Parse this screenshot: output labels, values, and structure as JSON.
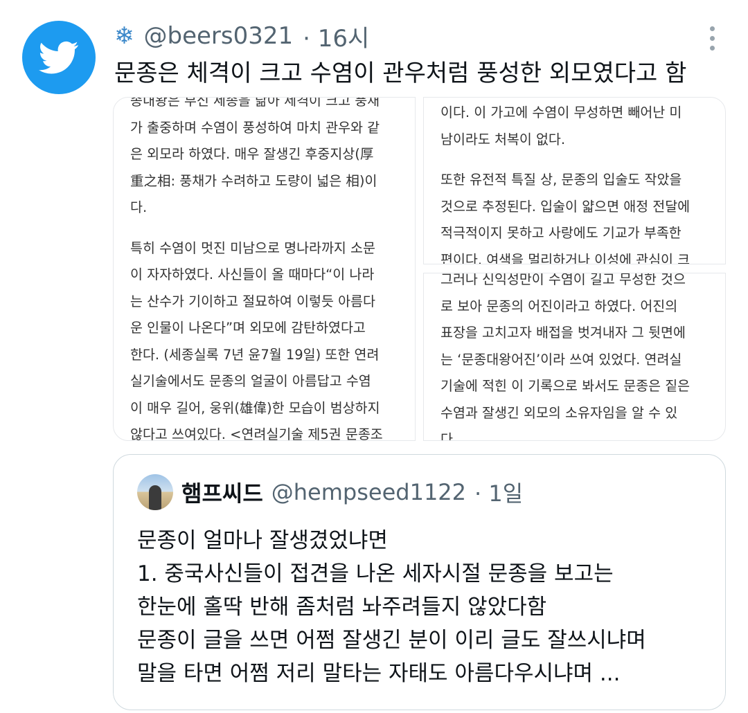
{
  "tweet": {
    "handle": "@beers0321",
    "time": "· 16시",
    "text": "문종은 체격이 크고 수염이 관우처럼 풍성한 외모였다고 함",
    "flair_icon": "snowflake-icon",
    "avatar_icon": "twitter-bird-icon",
    "accent_color": "#1d9bf0"
  },
  "media": {
    "left": [
      "종내왕은 부신 세종을 닮아 제격이 크고 풍채",
      "가 출중하며 수염이 풍성하여 마치 관우와 같",
      "은 외모라 하였다. 매우 잘생긴 후중지상(厚",
      "重之相: 풍채가 수려하고 도량이 넓은 相)이",
      "다.",
      "",
      "특히 수염이 멋진 미남으로 명나라까지 소문",
      "이 자자하였다. 사신들이 올 때마다“이 나라",
      "는 산수가 기이하고 절묘하여 이렇듯 아름다",
      "운 인물이 나온다”며 외모에 감탄하였다고",
      "한다. (세종실록 7년 윤7월 19일) 또한 연려",
      "실기술에서도 문종의 얼굴이 아름답고 수염",
      "이 매우 길어, 웅위(雄偉)한 모습이 범상하지",
      "않다고 쓰여있다. <연려실기술 제5권 문종조"
    ],
    "right_top": [
      "이다. 이 가고에 수염이 무성하면 빼어난 미",
      "남이라도 처복이 없다.",
      "",
      "또한 유전적 특질 상, 문종의 입술도 작았을",
      "것으로 추정된다. 입술이 얇으면 애정 전달에",
      "적극적이지 못하고 사랑에도 기교가 부족한",
      "편이다. 여색을 멀리하거나 이성에 관심이 크"
    ],
    "right_bottom": [
      "그러나 신익성만이 수염이 길고 무성한 것으",
      "로 보아 문종의 어진이라고 하였다. 어진의",
      "표장을 고치고자 배접을 벗겨내자 그 뒷면에",
      "는 ‘문종대왕어진’이라 쓰여 있었다. 연려실",
      "기술에 적힌 이 기록으로 봐서도 문종은 짙은",
      "수염과 잘생긴 외모의 소유자임을 알 수 있",
      "다."
    ]
  },
  "quote": {
    "name": "햄프씨드",
    "handle": "@hempseed1122",
    "time": "· 1일",
    "lines": [
      "문종이 얼마나 잘생겼었냐면",
      "1. 중국사신들이 접견을 나온 세자시절 문종을 보고는",
      "한눈에 홀딱 반해 좀처럼 놔주려들지 않았다함",
      "문종이 글을 쓰면 어쩜 잘생긴 분이 이리 글도 잘쓰시냐며",
      "말을 타면 어쩜 저리 말타는 자태도 아름다우시냐며 ..."
    ]
  }
}
